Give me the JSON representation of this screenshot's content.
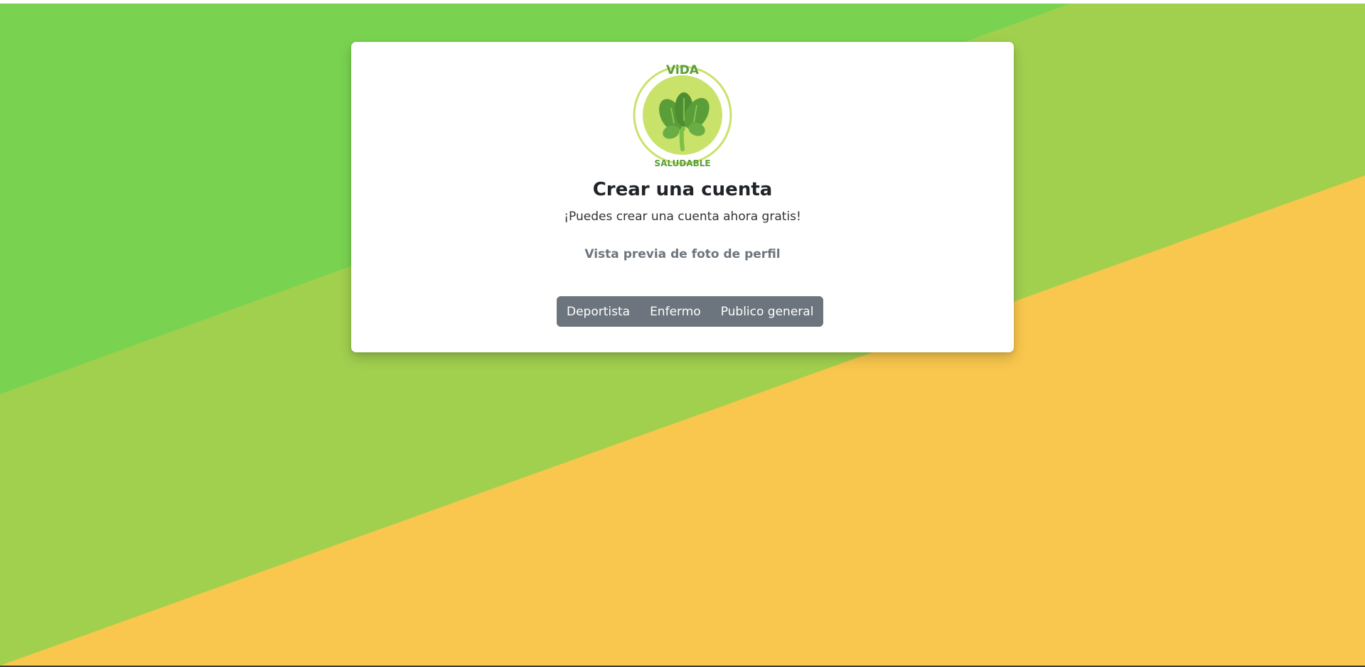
{
  "logo": {
    "top_text": "ViDA",
    "bottom_text": "SALUDABLE",
    "icon": "leafy-greens-icon"
  },
  "signup": {
    "title": "Crear una cuenta",
    "subtitle": "¡Puedes crear una cuenta ahora gratis!",
    "preview_label": "Vista previa de foto de perfil"
  },
  "profile_types": [
    {
      "label": "Deportista"
    },
    {
      "label": "Enfermo"
    },
    {
      "label": "Publico general"
    }
  ],
  "colors": {
    "background_green": "#79D350",
    "background_lime": "#A1D04F",
    "background_yellow": "#F9C74D",
    "button_gray": "#6C757D",
    "logo_green": "#5A9E3A",
    "logo_light": "#C8E26A"
  }
}
